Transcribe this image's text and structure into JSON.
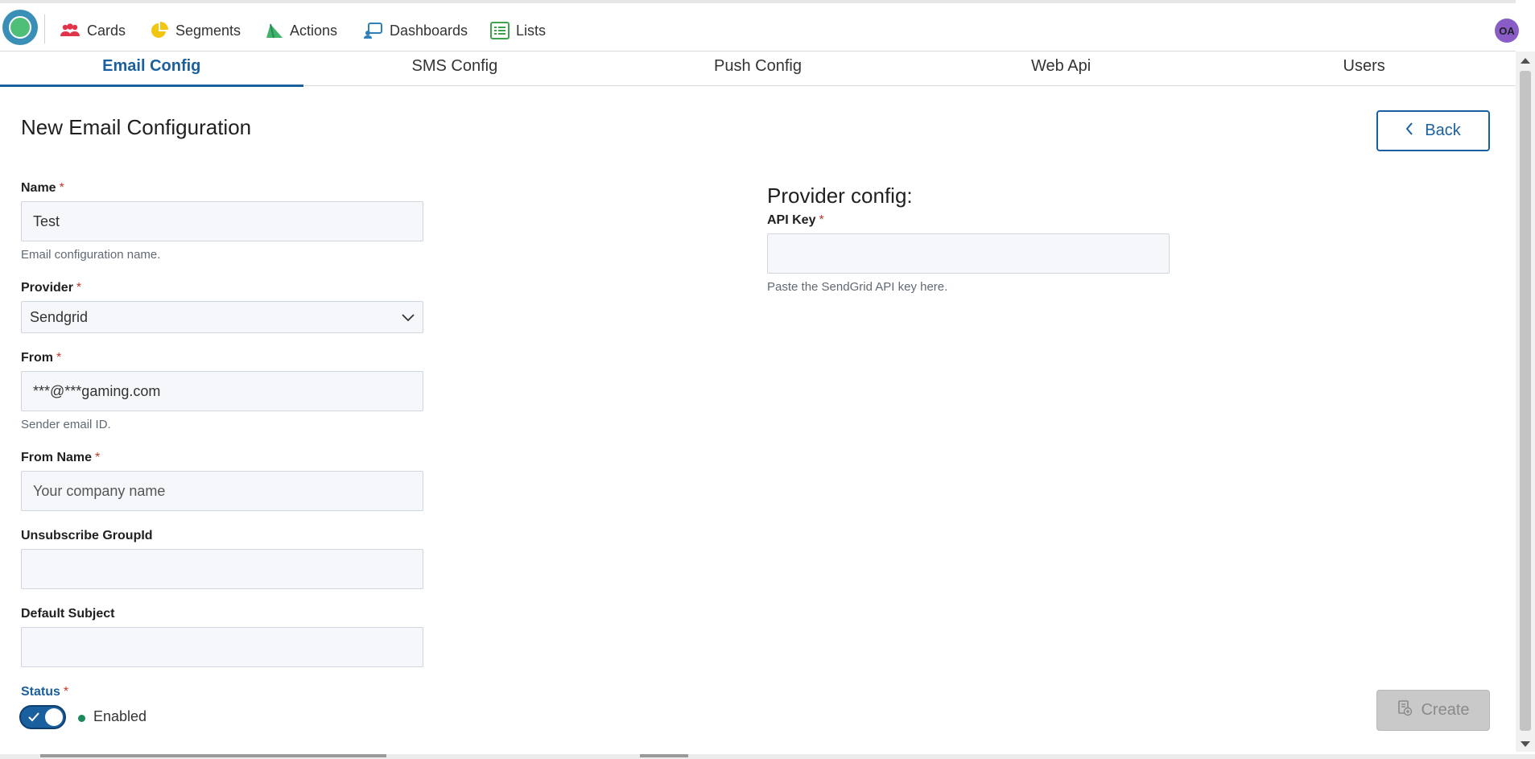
{
  "topnav": {
    "items": [
      {
        "label": "Cards",
        "icon": "users-icon"
      },
      {
        "label": "Segments",
        "icon": "pie-chart-icon"
      },
      {
        "label": "Actions",
        "icon": "actions-icon"
      },
      {
        "label": "Dashboards",
        "icon": "dashboard-icon"
      },
      {
        "label": "Lists",
        "icon": "list-icon"
      }
    ],
    "avatar_initials": "OA"
  },
  "tabs": [
    {
      "label": "Email Config",
      "active": true
    },
    {
      "label": "SMS Config",
      "active": false
    },
    {
      "label": "Push Config",
      "active": false
    },
    {
      "label": "Web Api",
      "active": false
    },
    {
      "label": "Users",
      "active": false
    }
  ],
  "page": {
    "title": "New Email Configuration",
    "back_label": "Back",
    "create_label": "Create"
  },
  "form": {
    "name": {
      "label": "Name",
      "required": "*",
      "value": "Test",
      "helper": "Email configuration name."
    },
    "provider": {
      "label": "Provider",
      "required": "*",
      "value": "Sendgrid"
    },
    "from": {
      "label": "From",
      "required": "*",
      "value": "***@***gaming.com",
      "helper": "Sender email ID."
    },
    "from_name": {
      "label": "From Name",
      "required": "*",
      "placeholder": "Your company name"
    },
    "unsubscribe": {
      "label": "Unsubscribe GroupId",
      "value": ""
    },
    "default_subject": {
      "label": "Default Subject",
      "value": ""
    },
    "status": {
      "label": "Status",
      "required": "*",
      "value_text": "Enabled",
      "enabled": true
    }
  },
  "provider_config": {
    "title": "Provider config:",
    "api_key": {
      "label": "API Key",
      "required": "*",
      "value": "",
      "helper": "Paste the SendGrid API key here."
    }
  },
  "colors": {
    "accent": "#1a5f9e",
    "required": "#c0392b",
    "status_dot": "#1b8a5a"
  }
}
